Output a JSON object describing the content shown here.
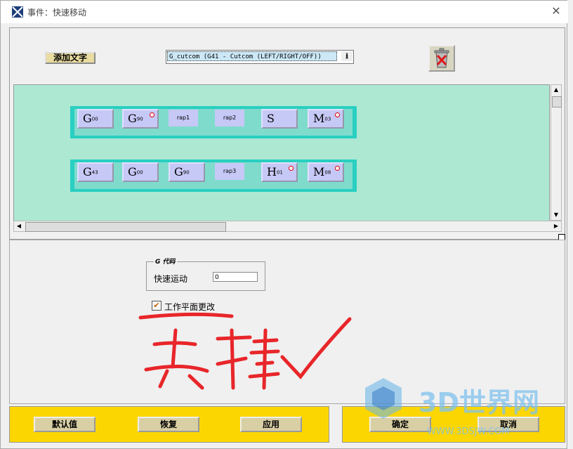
{
  "window": {
    "title": "事件：快速移动"
  },
  "toolbar": {
    "add_text_label": "添加文字",
    "cutcom_select_value": "G_cutcom (G41 - Cutcom (LEFT/RIGHT/OFF))"
  },
  "blocks": [
    {
      "buttons": [
        {
          "type": "g",
          "letter": "G",
          "sub": "00",
          "dot": false
        },
        {
          "type": "g",
          "letter": "G",
          "sub": "90",
          "dot": true
        },
        {
          "type": "r",
          "label": "rap1"
        },
        {
          "type": "r",
          "label": "rap2"
        },
        {
          "type": "g",
          "letter": "S",
          "sub": "",
          "dot": false
        },
        {
          "type": "g",
          "letter": "M",
          "sub": "03",
          "dot": true
        }
      ]
    },
    {
      "buttons": [
        {
          "type": "g",
          "letter": "G",
          "sub": "43",
          "dot": false
        },
        {
          "type": "g",
          "letter": "G",
          "sub": "00",
          "dot": false
        },
        {
          "type": "g",
          "letter": "G",
          "sub": "90",
          "dot": false
        },
        {
          "type": "r",
          "label": "rap3"
        },
        {
          "type": "g",
          "letter": "H",
          "sub": "01",
          "dot": true
        },
        {
          "type": "g",
          "letter": "M",
          "sub": "08",
          "dot": true
        }
      ]
    }
  ],
  "gcode_group": {
    "title": "G 代码",
    "rapid_label": "快速运动",
    "rapid_value": "0"
  },
  "workplane": {
    "label": "工作平面更改",
    "checked": true
  },
  "annotation": {
    "text": "去掉√",
    "color": "#e8262a"
  },
  "footer": {
    "default_label": "默认值",
    "restore_label": "恢复",
    "apply_label": "应用",
    "ok_label": "确定",
    "cancel_label": "取消"
  },
  "watermark": {
    "brand": "3D世界网",
    "url": "WWW.3DSJW.COM"
  },
  "colors": {
    "canvas_bg": "#ade8d3",
    "block_border": "#29cfc1",
    "button_fill": "#c6c8f6",
    "footer_bg": "#fcd600"
  }
}
